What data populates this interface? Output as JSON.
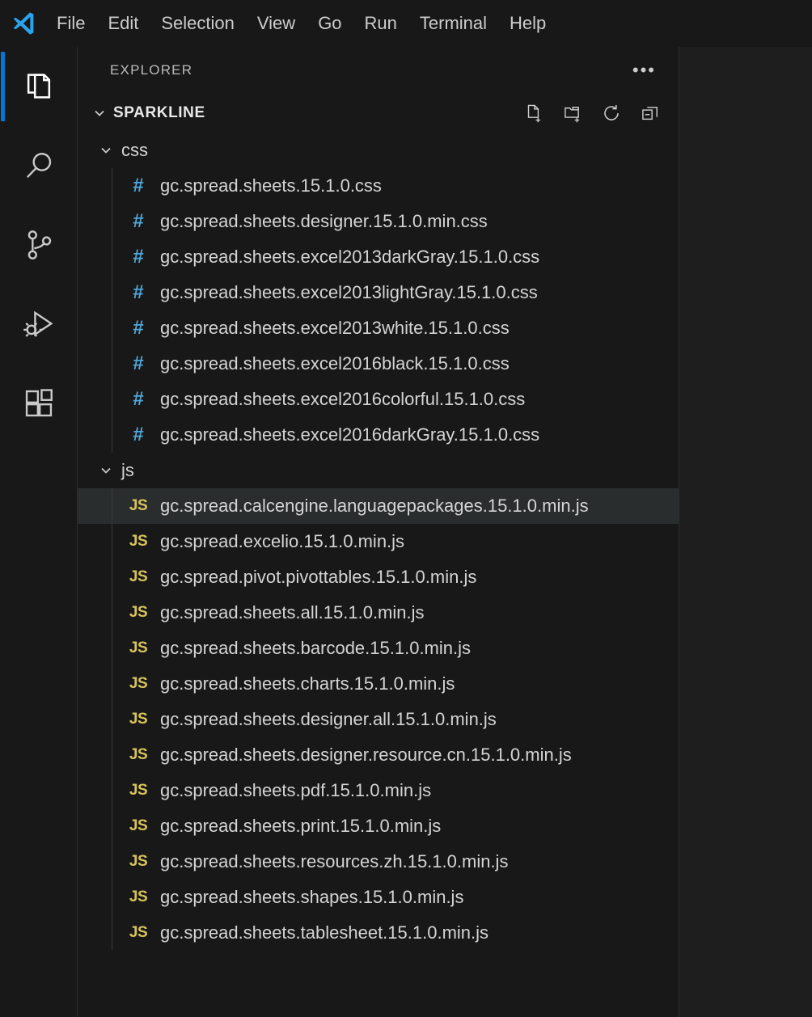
{
  "menubar": {
    "logo_icon": "vscode-logo-icon",
    "items": [
      {
        "label": "File"
      },
      {
        "label": "Edit"
      },
      {
        "label": "Selection"
      },
      {
        "label": "View"
      },
      {
        "label": "Go"
      },
      {
        "label": "Run"
      },
      {
        "label": "Terminal"
      },
      {
        "label": "Help"
      }
    ]
  },
  "activitybar": {
    "items": [
      {
        "name": "explorer",
        "icon": "files-icon",
        "active": true
      },
      {
        "name": "search",
        "icon": "search-icon",
        "active": false
      },
      {
        "name": "source-control",
        "icon": "source-control-icon",
        "active": false
      },
      {
        "name": "run-and-debug",
        "icon": "run-debug-icon",
        "active": false
      },
      {
        "name": "extensions",
        "icon": "extensions-icon",
        "active": false
      }
    ],
    "active_accent_color": "#0078d4"
  },
  "sidebar": {
    "title": "EXPLORER",
    "more_actions_label": "•••",
    "root": {
      "name": "SPARKLINE",
      "expanded": true,
      "actions": [
        {
          "name": "new-file",
          "icon": "new-file-icon"
        },
        {
          "name": "new-folder",
          "icon": "new-folder-icon"
        },
        {
          "name": "refresh",
          "icon": "refresh-icon"
        },
        {
          "name": "collapse-all",
          "icon": "collapse-all-icon"
        }
      ]
    },
    "folders": [
      {
        "name": "css",
        "expanded": true,
        "files": [
          {
            "name": "gc.spread.sheets.15.1.0.css",
            "type": "css",
            "icon_label": "#"
          },
          {
            "name": "gc.spread.sheets.designer.15.1.0.min.css",
            "type": "css",
            "icon_label": "#"
          },
          {
            "name": "gc.spread.sheets.excel2013darkGray.15.1.0.css",
            "type": "css",
            "icon_label": "#"
          },
          {
            "name": "gc.spread.sheets.excel2013lightGray.15.1.0.css",
            "type": "css",
            "icon_label": "#"
          },
          {
            "name": "gc.spread.sheets.excel2013white.15.1.0.css",
            "type": "css",
            "icon_label": "#"
          },
          {
            "name": "gc.spread.sheets.excel2016black.15.1.0.css",
            "type": "css",
            "icon_label": "#"
          },
          {
            "name": "gc.spread.sheets.excel2016colorful.15.1.0.css",
            "type": "css",
            "icon_label": "#"
          },
          {
            "name": "gc.spread.sheets.excel2016darkGray.15.1.0.css",
            "type": "css",
            "icon_label": "#"
          }
        ]
      },
      {
        "name": "js",
        "expanded": true,
        "files": [
          {
            "name": "gc.spread.calcengine.languagepackages.15.1.0.min.js",
            "type": "js",
            "icon_label": "JS",
            "highlighted": true
          },
          {
            "name": "gc.spread.excelio.15.1.0.min.js",
            "type": "js",
            "icon_label": "JS"
          },
          {
            "name": "gc.spread.pivot.pivottables.15.1.0.min.js",
            "type": "js",
            "icon_label": "JS"
          },
          {
            "name": "gc.spread.sheets.all.15.1.0.min.js",
            "type": "js",
            "icon_label": "JS"
          },
          {
            "name": "gc.spread.sheets.barcode.15.1.0.min.js",
            "type": "js",
            "icon_label": "JS"
          },
          {
            "name": "gc.spread.sheets.charts.15.1.0.min.js",
            "type": "js",
            "icon_label": "JS"
          },
          {
            "name": "gc.spread.sheets.designer.all.15.1.0.min.js",
            "type": "js",
            "icon_label": "JS"
          },
          {
            "name": "gc.spread.sheets.designer.resource.cn.15.1.0.min.js",
            "type": "js",
            "icon_label": "JS"
          },
          {
            "name": "gc.spread.sheets.pdf.15.1.0.min.js",
            "type": "js",
            "icon_label": "JS"
          },
          {
            "name": "gc.spread.sheets.print.15.1.0.min.js",
            "type": "js",
            "icon_label": "JS"
          },
          {
            "name": "gc.spread.sheets.resources.zh.15.1.0.min.js",
            "type": "js",
            "icon_label": "JS"
          },
          {
            "name": "gc.spread.sheets.shapes.15.1.0.min.js",
            "type": "js",
            "icon_label": "JS"
          },
          {
            "name": "gc.spread.sheets.tablesheet.15.1.0.min.js",
            "type": "js",
            "icon_label": "JS"
          }
        ]
      }
    ]
  },
  "colors": {
    "background": "#1e1e1e",
    "panel_background": "#181818",
    "row_highlight": "#2a2d2e",
    "text": "#d4d4d4",
    "css_icon": "#4fa6d8",
    "js_icon": "#d8c35a",
    "accent": "#0078d4"
  }
}
